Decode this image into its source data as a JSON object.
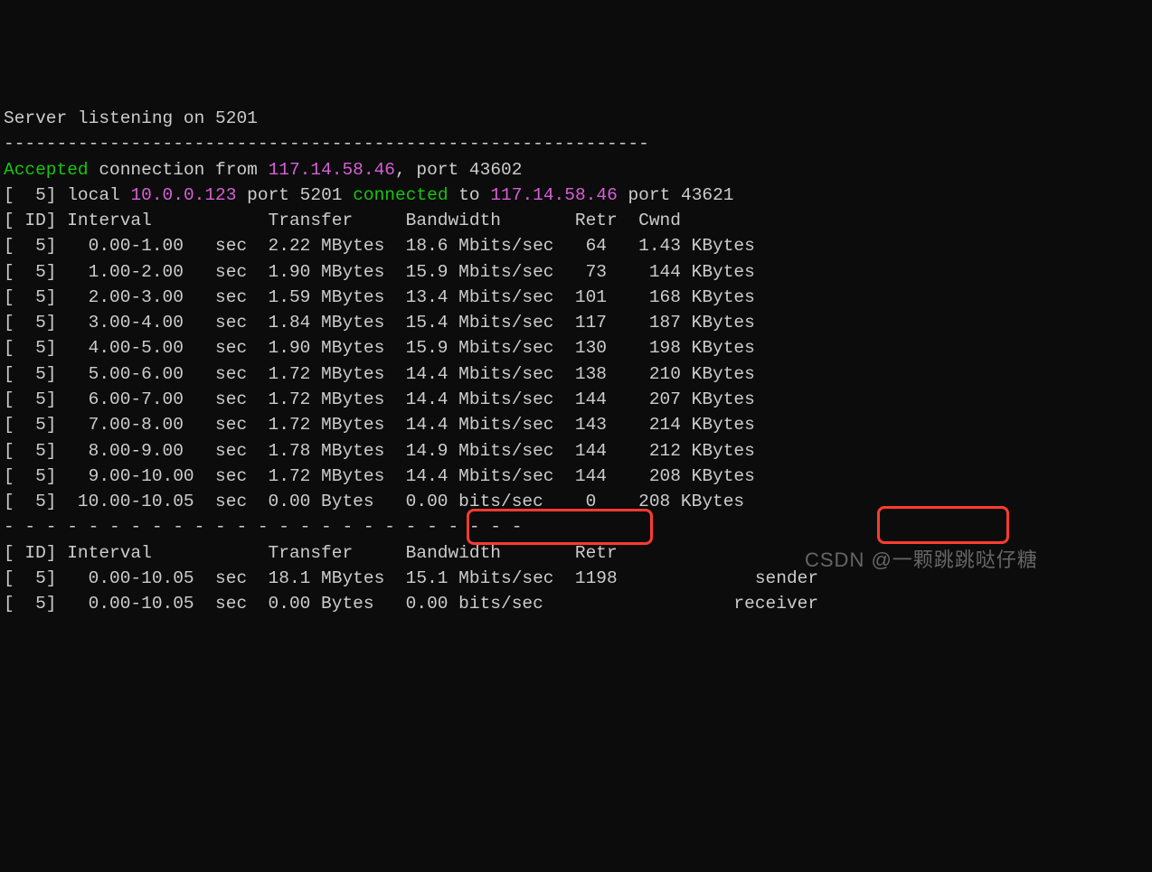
{
  "serverLine": "Server listening on 5201",
  "dash1": "-------------------------------------------------------------",
  "accepted_word": "Accepted",
  "accepted_mid": " connection from ",
  "accepted_ip": "117.14.58.46",
  "accepted_end": ", port 43602",
  "local_pre": "[  5] local ",
  "local_ip": "10.0.0.123",
  "local_mid1": " port 5201 ",
  "connected_word": "connected",
  "local_mid2": " to ",
  "remote_ip": "117.14.58.46",
  "local_end": " port 43621",
  "header1": "[ ID] Interval           Transfer     Bandwidth       Retr  Cwnd",
  "rows": [
    "[  5]   0.00-1.00   sec  2.22 MBytes  18.6 Mbits/sec   64   1.43 KBytes",
    "[  5]   1.00-2.00   sec  1.90 MBytes  15.9 Mbits/sec   73    144 KBytes",
    "[  5]   2.00-3.00   sec  1.59 MBytes  13.4 Mbits/sec  101    168 KBytes",
    "[  5]   3.00-4.00   sec  1.84 MBytes  15.4 Mbits/sec  117    187 KBytes",
    "[  5]   4.00-5.00   sec  1.90 MBytes  15.9 Mbits/sec  130    198 KBytes",
    "[  5]   5.00-6.00   sec  1.72 MBytes  14.4 Mbits/sec  138    210 KBytes",
    "[  5]   6.00-7.00   sec  1.72 MBytes  14.4 Mbits/sec  144    207 KBytes",
    "[  5]   7.00-8.00   sec  1.72 MBytes  14.4 Mbits/sec  143    214 KBytes",
    "[  5]   8.00-9.00   sec  1.78 MBytes  14.9 Mbits/sec  144    212 KBytes",
    "[  5]   9.00-10.00  sec  1.72 MBytes  14.4 Mbits/sec  144    208 KBytes",
    "[  5]  10.00-10.05  sec  0.00 Bytes   0.00 bits/sec    0    208 KBytes"
  ],
  "dash2": "- - - - - - - - - - - - - - - - - - - - - - - - -",
  "header2": "[ ID] Interval           Transfer     Bandwidth       Retr",
  "summary1": "[  5]   0.00-10.05  sec  18.1 MBytes  15.1 Mbits/sec  1198             sender",
  "summary2": "[  5]   0.00-10.05  sec  0.00 Bytes   0.00 bits/sec                  receiver",
  "watermark": "CSDN @一颗跳跳哒仔糖"
}
